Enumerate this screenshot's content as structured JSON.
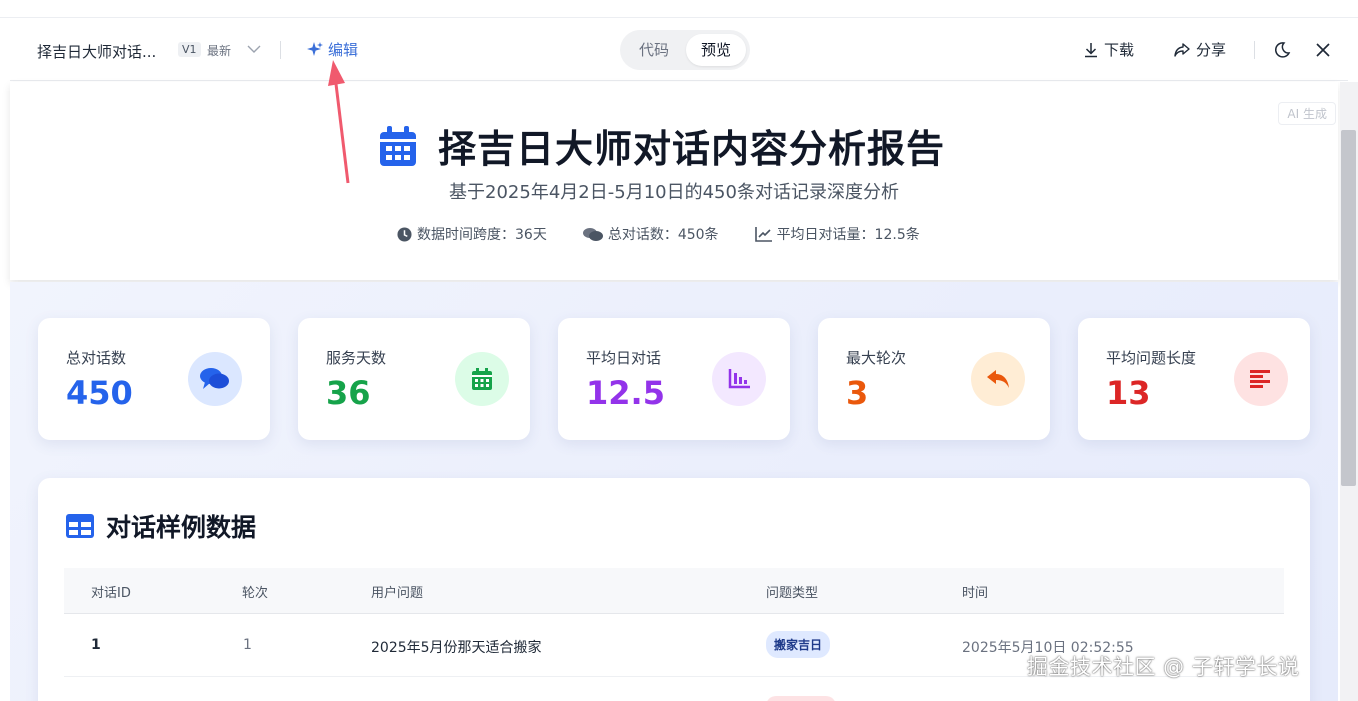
{
  "toolbar": {
    "doc_title": "择吉日大师对话...",
    "version": "V1",
    "latest": "最新",
    "edit_label": "编辑",
    "seg_code": "代码",
    "seg_preview": "预览",
    "download_label": "下载",
    "share_label": "分享"
  },
  "header": {
    "ai_badge": "AI 生成",
    "title": "择吉日大师对话内容分析报告",
    "subtitle": "基于2025年4月2日-5月10日的450条对话记录深度分析",
    "meta_span": "数据时间跨度：36天",
    "meta_total": "总对话数：450条",
    "meta_avg": "平均日对话量：12.5条"
  },
  "stats": [
    {
      "label": "总对话数",
      "value": "450",
      "color": "#2563eb",
      "bg": "#dbe7ff",
      "icon": "comments-icon"
    },
    {
      "label": "服务天数",
      "value": "36",
      "color": "#16a34a",
      "bg": "#dcfce7",
      "icon": "calendar-icon"
    },
    {
      "label": "平均日对话",
      "value": "12.5",
      "color": "#9333ea",
      "bg": "#f3e8ff",
      "icon": "chart-line-icon"
    },
    {
      "label": "最大轮次",
      "value": "3",
      "color": "#ea580c",
      "bg": "#ffedd5",
      "icon": "reply-icon"
    },
    {
      "label": "平均问题长度",
      "value": "13",
      "color": "#dc2626",
      "bg": "#fee2e2",
      "icon": "align-left-icon"
    }
  ],
  "table": {
    "title": "对话样例数据",
    "columns": [
      "对话ID",
      "轮次",
      "用户问题",
      "问题类型",
      "时间"
    ],
    "rows": [
      {
        "id": "1",
        "round": "1",
        "question": "2025年5月份那天适合搬家",
        "type": "搬家吉日",
        "time": "2025年5月10日 02:52:55"
      }
    ]
  },
  "watermark": "掘金技术社区 @ 子轩学长说"
}
